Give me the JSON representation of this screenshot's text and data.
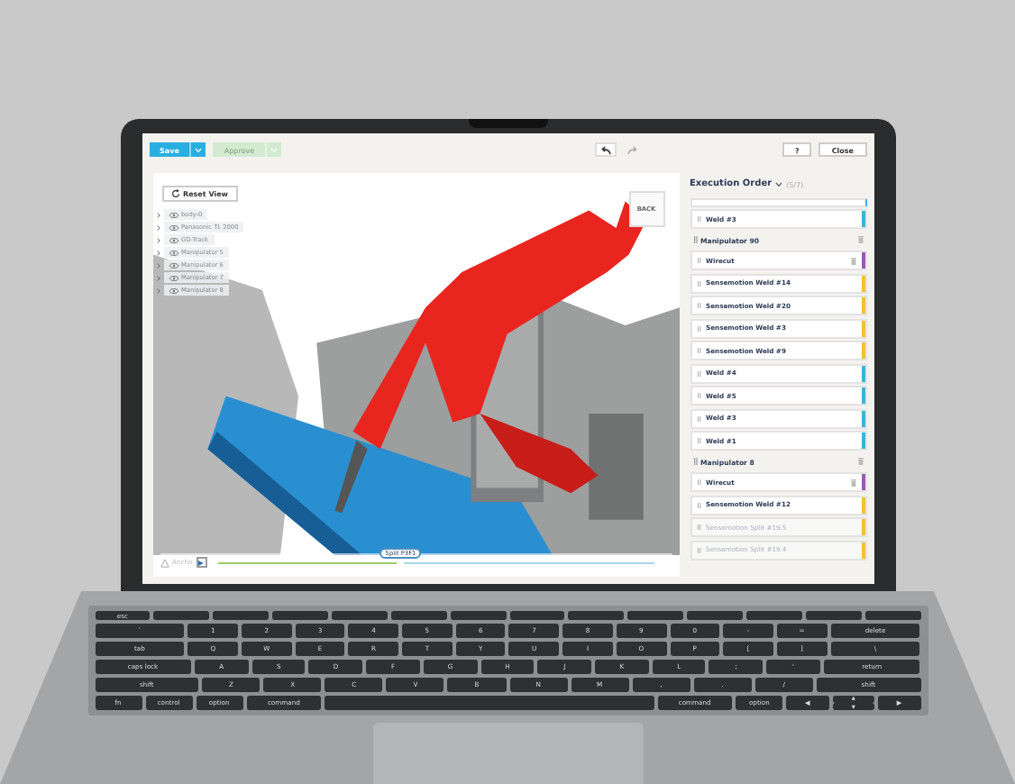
{
  "toolbar": {
    "save": "Save",
    "approve": {
      "label": "Approve",
      "disabled": true
    },
    "undo": {
      "disabled": false
    },
    "redo": {
      "disabled": true
    },
    "help": "?",
    "close": "Close"
  },
  "viewport": {
    "reset_view": "Reset View",
    "view_cube": "BACK",
    "tree": [
      {
        "label": "body-0"
      },
      {
        "label": "Panasonic TL 2000"
      },
      {
        "label": "GD-Track"
      },
      {
        "label": "Manipulator 5"
      },
      {
        "label": "Manipulator 6"
      },
      {
        "label": "Manipulator 7"
      },
      {
        "label": "Manipulator 8"
      }
    ],
    "timeline": {
      "label": "Ancho",
      "marker": "Split P3F1",
      "level": 0.42
    }
  },
  "panel": {
    "title": "Execution Order",
    "count": "(5/7)",
    "items": [
      {
        "kind": "step",
        "label": "Weld #3",
        "color": "#3bb4d8",
        "disabled": false,
        "deletable": false
      },
      {
        "kind": "header",
        "label": "Manipulator 90"
      },
      {
        "kind": "step",
        "label": "Wirecut",
        "color": "#9b59b6",
        "disabled": false,
        "deletable": true
      },
      {
        "kind": "step",
        "label": "Sensemotion Weld #14",
        "color": "#f2c12e",
        "disabled": false,
        "deletable": false
      },
      {
        "kind": "step",
        "label": "Sensemotion Weld #20",
        "color": "#f2c12e",
        "disabled": false,
        "deletable": false
      },
      {
        "kind": "step",
        "label": "Sensemotion Weld #3",
        "color": "#f2c12e",
        "disabled": false,
        "deletable": false
      },
      {
        "kind": "step",
        "label": "Sensemotion Weld #9",
        "color": "#f2c12e",
        "disabled": false,
        "deletable": false
      },
      {
        "kind": "step",
        "label": "Weld #4",
        "color": "#3bb4d8",
        "disabled": false,
        "deletable": false
      },
      {
        "kind": "step",
        "label": "Weld #5",
        "color": "#3bb4d8",
        "disabled": false,
        "deletable": false
      },
      {
        "kind": "step",
        "label": "Weld #3",
        "color": "#3bb4d8",
        "disabled": false,
        "deletable": false
      },
      {
        "kind": "step",
        "label": "Weld #1",
        "color": "#3bb4d8",
        "disabled": false,
        "deletable": false
      },
      {
        "kind": "header",
        "label": "Manipulator 8"
      },
      {
        "kind": "step",
        "label": "Wirecut",
        "color": "#9b59b6",
        "disabled": false,
        "deletable": true
      },
      {
        "kind": "step",
        "label": "Sensemotion Weld #12",
        "color": "#f2c12e",
        "disabled": false,
        "deletable": false
      },
      {
        "kind": "step",
        "label": "Sensemotion Split #19.5",
        "color": "#f2c12e",
        "disabled": true,
        "deletable": false
      },
      {
        "kind": "step",
        "label": "Sensemotion Split #19.4",
        "color": "#f2c12e",
        "disabled": true,
        "deletable": false
      }
    ]
  },
  "keyboard": {
    "escape": "esc",
    "rows": [
      {
        "keys": [
          "`",
          "1",
          "2",
          "3",
          "4",
          "5",
          "6",
          "7",
          "8",
          "9",
          "0",
          "-",
          "=",
          "delete"
        ]
      },
      {
        "keys": [
          "tab",
          "Q",
          "W",
          "E",
          "R",
          "T",
          "Y",
          "U",
          "I",
          "O",
          "P",
          "[",
          "]",
          "\\"
        ]
      },
      {
        "keys": [
          "caps lock",
          "A",
          "S",
          "D",
          "F",
          "G",
          "H",
          "J",
          "K",
          "L",
          ";",
          "'",
          "return"
        ]
      },
      {
        "keys": [
          "shift",
          "Z",
          "X",
          "C",
          "V",
          "B",
          "N",
          "M",
          ",",
          ".",
          "/",
          "shift"
        ]
      }
    ],
    "bottom_left": [
      "fn",
      "control",
      "option",
      "command"
    ],
    "bottom_right": [
      "command",
      "option"
    ],
    "arrows": [
      "◀",
      "▲",
      "▼",
      "▶"
    ]
  }
}
